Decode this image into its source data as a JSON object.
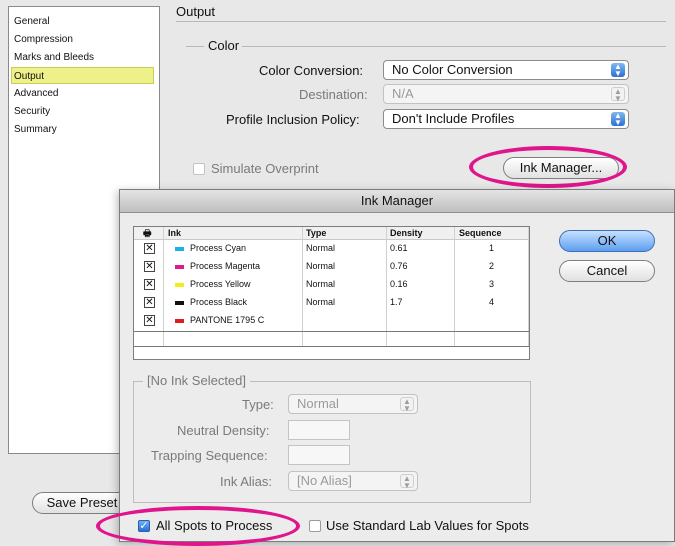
{
  "sidebar": {
    "items": [
      {
        "label": "General"
      },
      {
        "label": "Compression"
      },
      {
        "label": "Marks and Bleeds"
      },
      {
        "label": "Output"
      },
      {
        "label": "Advanced"
      },
      {
        "label": "Security"
      },
      {
        "label": "Summary"
      }
    ],
    "selected": "Output"
  },
  "panel": {
    "title": "Output",
    "color_group": "Color",
    "color_conversion_label": "Color Conversion:",
    "color_conversion_value": "No Color Conversion",
    "destination_label": "Destination:",
    "destination_value": "N/A",
    "profile_label": "Profile Inclusion Policy:",
    "profile_value": "Don't Include Profiles",
    "simulate_overprint": "Simulate Overprint",
    "ink_manager_button": "Ink Manager...",
    "save_preset": "Save Preset"
  },
  "dialog": {
    "title": "Ink Manager",
    "columns": [
      "Ink",
      "Type",
      "Density",
      "Sequence"
    ],
    "rows": [
      {
        "ink": "Process Cyan",
        "type": "Normal",
        "density": "0.61",
        "sequence": "1",
        "color": "#19b2e6"
      },
      {
        "ink": "Process Magenta",
        "type": "Normal",
        "density": "0.76",
        "sequence": "2",
        "color": "#e0198c"
      },
      {
        "ink": "Process Yellow",
        "type": "Normal",
        "density": "0.16",
        "sequence": "3",
        "color": "#f3ec1c"
      },
      {
        "ink": "Process Black",
        "type": "Normal",
        "density": "1.7",
        "sequence": "4",
        "color": "#111111"
      },
      {
        "ink": "PANTONE 1795 C",
        "type": "",
        "density": "",
        "sequence": "",
        "color": "#e01b22"
      }
    ],
    "ok": "OK",
    "cancel": "Cancel",
    "no_ink_selected": "[No Ink Selected]",
    "type_label": "Type:",
    "type_value": "Normal",
    "neutral_density_label": "Neutral Density:",
    "trapping_sequence_label": "Trapping Sequence:",
    "ink_alias_label": "Ink Alias:",
    "ink_alias_value": "[No Alias]",
    "all_spots_to_process": "All Spots to Process",
    "use_standard_lab": "Use Standard Lab Values for Spots"
  },
  "colors": {
    "accent_highlight": "#e0158c",
    "selection": "#eef08a"
  }
}
